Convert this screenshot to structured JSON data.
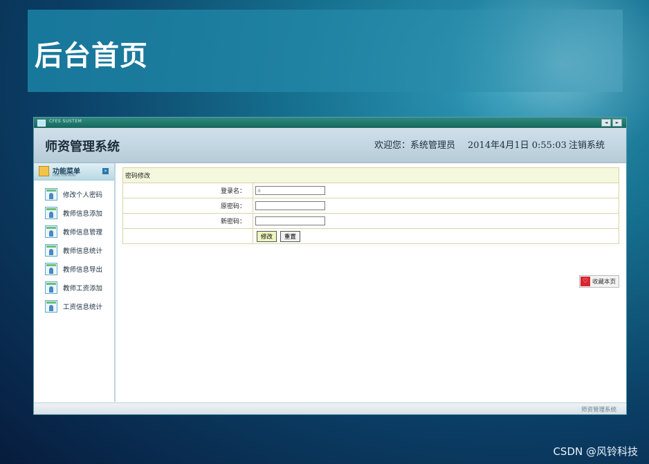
{
  "slide": {
    "title": "后台首页",
    "watermark": "CSDN @风铃科技"
  },
  "window": {
    "titlebar_text": "CFES SUSTEM",
    "titlebar_buttons": [
      "◄",
      "►"
    ]
  },
  "header": {
    "system_title": "师资管理系统",
    "welcome": "欢迎您：系统管理员",
    "datetime": "2014年4月1日 0:55:03",
    "logout": "注销系统"
  },
  "sidebar": {
    "title": "功能菜单",
    "subtitle": "FUNCTION MENU",
    "toggle_icon": "»",
    "items": [
      {
        "label": "修改个人密码"
      },
      {
        "label": "教师信息添加"
      },
      {
        "label": "教师信息管理"
      },
      {
        "label": "教师信息统计"
      },
      {
        "label": "教师信息导出"
      },
      {
        "label": "教师工资添加"
      },
      {
        "label": "工资信息统计"
      }
    ]
  },
  "form": {
    "caption": "密码修改",
    "username_label": "登录名：",
    "username_value": "a",
    "old_password_label": "原密码：",
    "new_password_label": "新密码：",
    "submit_label": "修改",
    "reset_label": "重置"
  },
  "bookmark": {
    "icon": "♡",
    "label": "收藏本页"
  },
  "footer": {
    "text": "师资管理系统"
  },
  "colors": {
    "titlebar": "#17675d",
    "header_bg": "#c2d6e1",
    "form_border": "#d9d2a8",
    "form_caption_bg": "#f4f8dc"
  }
}
